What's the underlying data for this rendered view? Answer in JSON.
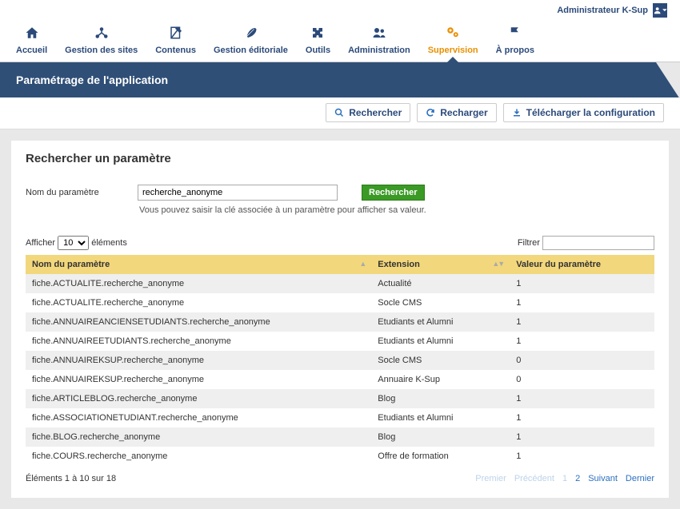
{
  "user": {
    "name": "Administrateur K-Sup"
  },
  "nav": {
    "items": [
      {
        "label": "Accueil",
        "icon": "home"
      },
      {
        "label": "Gestion des sites",
        "icon": "sites"
      },
      {
        "label": "Contenus",
        "icon": "contenus"
      },
      {
        "label": "Gestion éditoriale",
        "icon": "edit"
      },
      {
        "label": "Outils",
        "icon": "tools"
      },
      {
        "label": "Administration",
        "icon": "admin"
      },
      {
        "label": "Supervision",
        "icon": "supervision",
        "active": true
      },
      {
        "label": "À propos",
        "icon": "about"
      }
    ]
  },
  "title": "Paramétrage de l'application",
  "actions": {
    "search": "Rechercher",
    "reload": "Recharger",
    "download": "Télécharger la configuration"
  },
  "searchform": {
    "heading": "Rechercher un paramètre",
    "label": "Nom du paramètre",
    "value": "recherche_anonyme",
    "button": "Rechercher",
    "hint": "Vous pouvez saisir la clé associée à un paramètre pour afficher sa valeur."
  },
  "table": {
    "show_prefix": "Afficher",
    "show_value": "10",
    "show_suffix": "éléments",
    "filter_label": "Filtrer",
    "filter_value": "",
    "columns": {
      "name": "Nom du paramètre",
      "extension": "Extension",
      "value": "Valeur du paramètre"
    },
    "rows": [
      {
        "name": "fiche.ACTUALITE.recherche_anonyme",
        "extension": "Actualité",
        "value": "1"
      },
      {
        "name": "fiche.ACTUALITE.recherche_anonyme",
        "extension": "Socle CMS",
        "value": "1"
      },
      {
        "name": "fiche.ANNUAIREANCIENSETUDIANTS.recherche_anonyme",
        "extension": "Etudiants et Alumni",
        "value": "1"
      },
      {
        "name": "fiche.ANNUAIREETUDIANTS.recherche_anonyme",
        "extension": "Etudiants et Alumni",
        "value": "1"
      },
      {
        "name": "fiche.ANNUAIREKSUP.recherche_anonyme",
        "extension": "Socle CMS",
        "value": "0"
      },
      {
        "name": "fiche.ANNUAIREKSUP.recherche_anonyme",
        "extension": "Annuaire K-Sup",
        "value": "0"
      },
      {
        "name": "fiche.ARTICLEBLOG.recherche_anonyme",
        "extension": "Blog",
        "value": "1"
      },
      {
        "name": "fiche.ASSOCIATIONETUDIANT.recherche_anonyme",
        "extension": "Etudiants et Alumni",
        "value": "1"
      },
      {
        "name": "fiche.BLOG.recherche_anonyme",
        "extension": "Blog",
        "value": "1"
      },
      {
        "name": "fiche.COURS.recherche_anonyme",
        "extension": "Offre de formation",
        "value": "1"
      }
    ],
    "info": "Éléments 1 à 10 sur 18",
    "pagination": {
      "first": "Premier",
      "prev": "Précédent",
      "next": "Suivant",
      "last": "Dernier",
      "pages": [
        "1",
        "2"
      ],
      "current": "1"
    }
  }
}
